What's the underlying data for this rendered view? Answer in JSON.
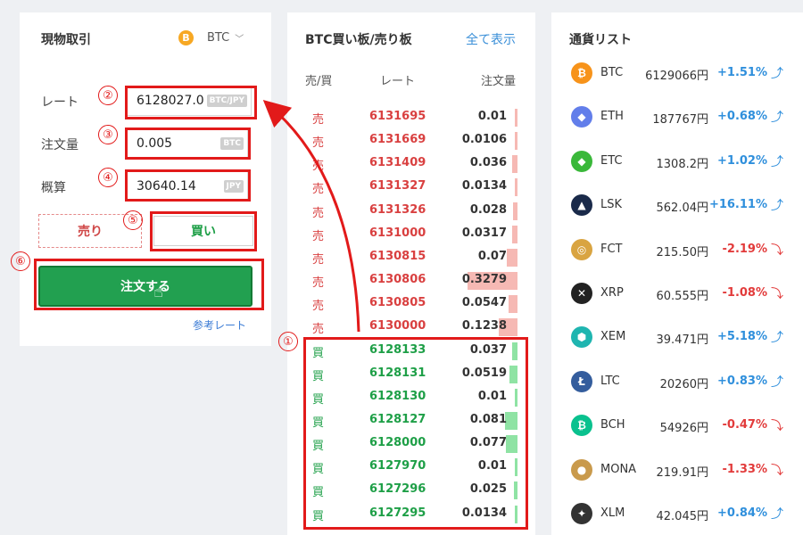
{
  "trade": {
    "title": "現物取引",
    "coin_icon": "B",
    "coin": "BTC",
    "rate_label": "レート",
    "rate_value": "6128027.0",
    "rate_unit": "BTC/JPY",
    "qty_label": "注文量",
    "qty_value": "0.005",
    "qty_unit": "BTC",
    "est_label": "概算",
    "est_value": "30640.14",
    "est_unit": "JPY",
    "sell_label": "売り",
    "buy_label": "買い",
    "order_label": "注文する",
    "ref_label": "参考レート"
  },
  "markers": [
    "①",
    "②",
    "③",
    "④",
    "⑤",
    "⑥"
  ],
  "book": {
    "title": "BTC買い板/売り板",
    "show_all": "全て表示",
    "col_side": "売/買",
    "col_rate": "レート",
    "col_qty": "注文量",
    "asks": [
      {
        "side": "売",
        "rate": "6131695",
        "qty": "0.01",
        "depth": 0.04
      },
      {
        "side": "売",
        "rate": "6131669",
        "qty": "0.0106",
        "depth": 0.04
      },
      {
        "side": "売",
        "rate": "6131409",
        "qty": "0.036",
        "depth": 0.11
      },
      {
        "side": "売",
        "rate": "6131327",
        "qty": "0.0134",
        "depth": 0.05
      },
      {
        "side": "売",
        "rate": "6131326",
        "qty": "0.028",
        "depth": 0.09
      },
      {
        "side": "売",
        "rate": "6131000",
        "qty": "0.0317",
        "depth": 0.1
      },
      {
        "side": "売",
        "rate": "6130815",
        "qty": "0.07",
        "depth": 0.21
      },
      {
        "side": "売",
        "rate": "6130806",
        "qty": "0.3279",
        "depth": 1.0
      },
      {
        "side": "売",
        "rate": "6130805",
        "qty": "0.0547",
        "depth": 0.17
      },
      {
        "side": "売",
        "rate": "6130000",
        "qty": "0.1238",
        "depth": 0.38
      }
    ],
    "bids": [
      {
        "side": "買",
        "rate": "6128133",
        "qty": "0.037",
        "depth": 0.11
      },
      {
        "side": "買",
        "rate": "6128131",
        "qty": "0.0519",
        "depth": 0.16
      },
      {
        "side": "買",
        "rate": "6128130",
        "qty": "0.01",
        "depth": 0.04
      },
      {
        "side": "買",
        "rate": "6128127",
        "qty": "0.081",
        "depth": 0.25
      },
      {
        "side": "買",
        "rate": "6128000",
        "qty": "0.077",
        "depth": 0.24
      },
      {
        "side": "買",
        "rate": "6127970",
        "qty": "0.01",
        "depth": 0.04
      },
      {
        "side": "買",
        "rate": "6127296",
        "qty": "0.025",
        "depth": 0.08
      },
      {
        "side": "買",
        "rate": "6127295",
        "qty": "0.0134",
        "depth": 0.05
      }
    ]
  },
  "currency": {
    "title": "通貨リスト",
    "items": [
      {
        "symbol": "BTC",
        "price": "6129066円",
        "change": "+1.51%",
        "dir": "up",
        "icon": "bitcoin-icon",
        "color": "#f7931a",
        "glyph": "₿"
      },
      {
        "symbol": "ETH",
        "price": "187767円",
        "change": "+0.68%",
        "dir": "up",
        "icon": "ethereum-icon",
        "color": "#627eea",
        "glyph": "◆"
      },
      {
        "symbol": "ETC",
        "price": "1308.2円",
        "change": "+1.02%",
        "dir": "up",
        "icon": "ethereum-classic-icon",
        "color": "#3ab83a",
        "glyph": "◆"
      },
      {
        "symbol": "LSK",
        "price": "562.04円",
        "change": "+16.11%",
        "dir": "up",
        "icon": "lisk-icon",
        "color": "#1a2a4a",
        "glyph": "▲"
      },
      {
        "symbol": "FCT",
        "price": "215.50円",
        "change": "-2.19%",
        "dir": "down",
        "icon": "factom-icon",
        "color": "#d9a441",
        "glyph": "◎"
      },
      {
        "symbol": "XRP",
        "price": "60.555円",
        "change": "-1.08%",
        "dir": "down",
        "icon": "ripple-icon",
        "color": "#222222",
        "glyph": "✕"
      },
      {
        "symbol": "XEM",
        "price": "39.471円",
        "change": "+5.18%",
        "dir": "up",
        "icon": "nem-icon",
        "color": "#1fb5b0",
        "glyph": "⬢"
      },
      {
        "symbol": "LTC",
        "price": "20260円",
        "change": "+0.83%",
        "dir": "up",
        "icon": "litecoin-icon",
        "color": "#345d9d",
        "glyph": "Ł"
      },
      {
        "symbol": "BCH",
        "price": "54926円",
        "change": "-0.47%",
        "dir": "down",
        "icon": "bitcoin-cash-icon",
        "color": "#0ac18e",
        "glyph": "₿"
      },
      {
        "symbol": "MONA",
        "price": "219.91円",
        "change": "-1.33%",
        "dir": "down",
        "icon": "monacoin-icon",
        "color": "#c99a4c",
        "glyph": "●"
      },
      {
        "symbol": "XLM",
        "price": "42.045円",
        "change": "+0.84%",
        "dir": "up",
        "icon": "stellar-icon",
        "color": "#333333",
        "glyph": "✦"
      }
    ]
  },
  "colors": {
    "accent_red": "#e21a1a",
    "buy_green": "#1e9f47",
    "sell_red": "#d94040",
    "link_blue": "#3a8fd8"
  }
}
